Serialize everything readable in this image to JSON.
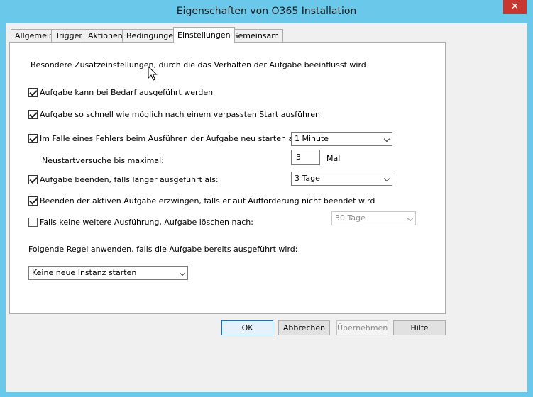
{
  "window": {
    "title": "Eigenschaften von O365 Installation",
    "close_label": "✕"
  },
  "tabs": [
    {
      "label": "Allgemein"
    },
    {
      "label": "Trigger"
    },
    {
      "label": "Aktionen"
    },
    {
      "label": "Bedingungen"
    },
    {
      "label": "Einstellungen",
      "active": true
    },
    {
      "label": "Gemeinsam"
    }
  ],
  "settings": {
    "description": "Besondere Zusatzeinstellungen, durch die das Verhalten der Aufgabe beeinflusst wird",
    "on_demand": {
      "label": "Aufgabe kann bei Bedarf ausgeführt werden",
      "checked": true
    },
    "missed_start": {
      "label": "Aufgabe so schnell wie möglich nach einem verpassten Start ausführen",
      "checked": true
    },
    "restart_on_fail": {
      "label": "Im Falle eines Fehlers beim Ausführen der Aufgabe neu starten alle:",
      "checked": true,
      "interval": "1 Minute"
    },
    "restart_attempts": {
      "label": "Neustartversuche bis maximal:",
      "value": "3",
      "unit": "Mal"
    },
    "stop_if_runs_longer": {
      "label": "Aufgabe beenden, falls länger ausgeführt als:",
      "checked": true,
      "duration": "3 Tage"
    },
    "force_stop": {
      "label": "Beenden der aktiven Aufgabe erzwingen, falls er auf Aufforderung nicht beendet wird",
      "checked": true
    },
    "delete_after": {
      "label": "Falls keine weitere Ausführung, Aufgabe löschen nach:",
      "checked": false,
      "duration": "30 Tage"
    },
    "rule": {
      "label": "Folgende Regel anwenden, falls die Aufgabe bereits ausgeführt wird:",
      "value": "Keine neue Instanz starten"
    }
  },
  "buttons": {
    "ok": "OK",
    "cancel": "Abbrechen",
    "apply": "Übernehmen",
    "help": "Hilfe"
  }
}
